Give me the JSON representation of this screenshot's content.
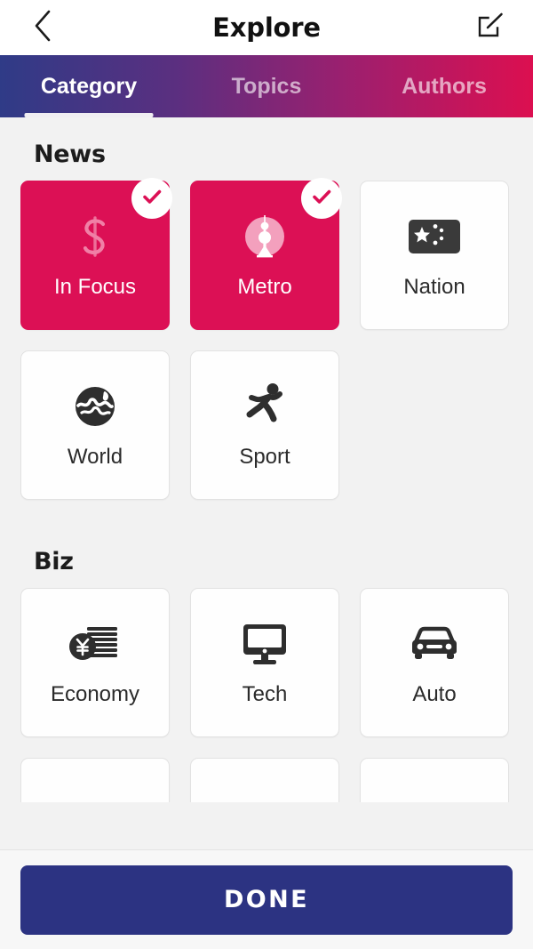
{
  "header": {
    "title": "Explore",
    "back_icon": "chevron-left-icon",
    "edit_icon": "compose-edit-icon"
  },
  "tabs": [
    {
      "label": "Category",
      "active": true
    },
    {
      "label": "Topics",
      "active": false
    },
    {
      "label": "Authors",
      "active": false
    }
  ],
  "sections": [
    {
      "title": "News",
      "cards": [
        {
          "label": "In Focus",
          "icon": "s-monogram-icon",
          "selected": true
        },
        {
          "label": "Metro",
          "icon": "pearl-tower-icon",
          "selected": true
        },
        {
          "label": "Nation",
          "icon": "flag-stars-icon",
          "selected": false
        },
        {
          "label": "World",
          "icon": "globe-icon",
          "selected": false
        },
        {
          "label": "Sport",
          "icon": "running-person-icon",
          "selected": false
        }
      ]
    },
    {
      "title": "Biz",
      "cards": [
        {
          "label": "Economy",
          "icon": "yen-coins-icon",
          "selected": false
        },
        {
          "label": "Tech",
          "icon": "monitor-icon",
          "selected": false
        },
        {
          "label": "Auto",
          "icon": "car-front-icon",
          "selected": false
        }
      ],
      "clipped_cards": [
        {
          "icon": "boat-icon"
        },
        {
          "icon": "bank-building-icon"
        },
        {
          "icon": "plane-icon"
        }
      ]
    }
  ],
  "footer": {
    "done_label": "DONE"
  },
  "colors": {
    "selected_card": "#dc1055",
    "done_button": "#2c3382",
    "tab_gradient_start": "#2f3b87",
    "tab_gradient_end": "#dc0f50",
    "page_background": "#f2f2f2"
  }
}
